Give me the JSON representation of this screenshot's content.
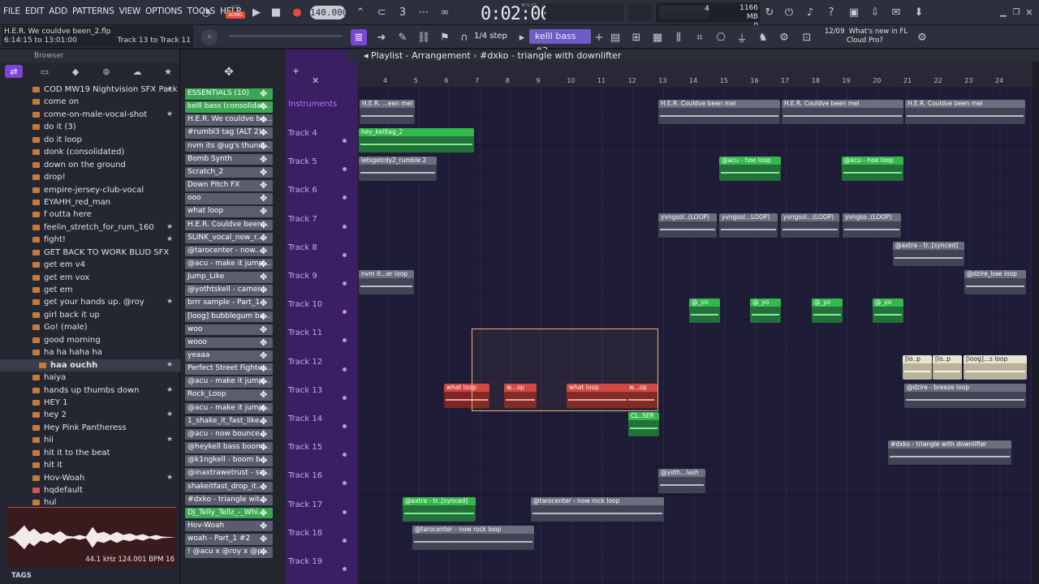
{
  "menu": [
    "FILE",
    "EDIT",
    "ADD",
    "PATTERNS",
    "VIEW",
    "OPTIONS",
    "TOOLS",
    "HELP"
  ],
  "transport": {
    "pat_label": "PAT",
    "song_label": "SONG",
    "tempo": "140.000",
    "time_unit": "M:S:CS",
    "time": "0:02:00",
    "cpu": "4",
    "memory": "1166 MB",
    "polyphony": "0"
  },
  "hint": {
    "file": "H.E.R. We couldve been_2.flp",
    "range": "6:14:15 to 13:01:00",
    "tracks": "Track 13 to Track 11"
  },
  "toolbar": {
    "snap": "1/4 step",
    "pattern": "kelll bass #2"
  },
  "news": {
    "date": "12/09",
    "line1": "What's new in FL",
    "line2": "Cloud Pro?"
  },
  "browser": {
    "title": "Browser",
    "items": [
      {
        "label": "COD MW19  Nightvision SFX Pack HQ",
        "star": true
      },
      {
        "label": "come on",
        "star": false
      },
      {
        "label": "come-on-male-vocal-shot",
        "star": true
      },
      {
        "label": "do it (3)",
        "star": false
      },
      {
        "label": "do it loop",
        "star": false
      },
      {
        "label": "donk (consolidated)",
        "star": false
      },
      {
        "label": "down on the ground",
        "star": false
      },
      {
        "label": "drop!",
        "star": false
      },
      {
        "label": "empire-jersey-club-vocal",
        "star": false
      },
      {
        "label": "EYAHH_red_man",
        "star": false
      },
      {
        "label": "f outta here",
        "star": false
      },
      {
        "label": "feelin_stretch_for_rum_160",
        "star": true
      },
      {
        "label": "fight!",
        "star": true
      },
      {
        "label": "GET BACK TO WORK BLUD SFX",
        "star": false
      },
      {
        "label": "get em v4",
        "star": false
      },
      {
        "label": "get em vox",
        "star": false
      },
      {
        "label": "get em",
        "star": false
      },
      {
        "label": "get your hands up. @roy",
        "star": true
      },
      {
        "label": "girl back it up",
        "star": false
      },
      {
        "label": "Go! (male)",
        "star": false
      },
      {
        "label": "good morning",
        "star": false
      },
      {
        "label": "ha ha haha ha",
        "star": false
      },
      {
        "label": "haa ouchh",
        "star": true,
        "selected": true
      },
      {
        "label": "haiya",
        "star": false
      },
      {
        "label": "hands up thumbs down",
        "star": true
      },
      {
        "label": "HEY 1",
        "star": false
      },
      {
        "label": "hey 2",
        "star": true
      },
      {
        "label": "Hey Pink Pantheress",
        "star": false
      },
      {
        "label": "hii",
        "star": true
      },
      {
        "label": "hit it to the beat",
        "star": false
      },
      {
        "label": "hit it",
        "star": false
      },
      {
        "label": "Hov-Woah",
        "star": true
      },
      {
        "label": "hqdefault",
        "star": false,
        "folder": true
      },
      {
        "label": "hul",
        "star": false
      }
    ],
    "wave_info": "44.1 kHz 124.001 BPM 16",
    "tags_label": "TAGS"
  },
  "patterns": [
    {
      "label": "ESSENTIALS (10)",
      "color": "green"
    },
    {
      "label": "kelll bass (consolidat...",
      "color": "green"
    },
    {
      "label": "H.E.R. We couldve be...",
      "color": "grey"
    },
    {
      "label": "#rumbl3 tag (ALT 2)...",
      "color": "grey"
    },
    {
      "label": "nvm its @ug's thund...",
      "color": "grey"
    },
    {
      "label": "Bomb Synth",
      "color": "grey"
    },
    {
      "label": "Scratch_2",
      "color": "grey"
    },
    {
      "label": "Down Pitch FX",
      "color": "grey"
    },
    {
      "label": "ooo",
      "color": "grey"
    },
    {
      "label": "what loop",
      "color": "grey"
    },
    {
      "label": "H.E.R. Couldve been...",
      "color": "grey"
    },
    {
      "label": "SLINK_vocal_now_r...",
      "color": "grey"
    },
    {
      "label": "@tarocenter - now...",
      "color": "grey"
    },
    {
      "label": "@acu - make it jump...",
      "color": "grey"
    },
    {
      "label": "Jump_Like",
      "color": "grey"
    },
    {
      "label": "@yothtskell - camer...",
      "color": "grey"
    },
    {
      "label": "brrr sample - Part_1",
      "color": "grey"
    },
    {
      "label": "[loog] bubblegum ba...",
      "color": "grey"
    },
    {
      "label": "woo",
      "color": "grey"
    },
    {
      "label": "wooo",
      "color": "grey"
    },
    {
      "label": "yeaaa",
      "color": "grey"
    },
    {
      "label": "Perfect Street Fighter...",
      "color": "grey"
    },
    {
      "label": "@acu - make it jump...",
      "color": "grey"
    },
    {
      "label": "Rock_Loop",
      "color": "grey"
    },
    {
      "label": "@acu - make it jump...",
      "color": "grey"
    },
    {
      "label": "1_shake_it_fast_like...",
      "color": "grey"
    },
    {
      "label": "@acu - now bounce...",
      "color": "grey"
    },
    {
      "label": "@heykell bass boom...",
      "color": "grey"
    },
    {
      "label": "@k1ngkell - boom b...",
      "color": "grey"
    },
    {
      "label": "@inaxtrawetrust - sc...",
      "color": "grey"
    },
    {
      "label": "shakeitfast_drop_it...",
      "color": "grey"
    },
    {
      "label": "#dxko - triangle wit...",
      "color": "grey"
    },
    {
      "label": "DJ_Telly_Tellz_-_Whi...",
      "color": "green"
    },
    {
      "label": "Hov-Woah",
      "color": "grey"
    },
    {
      "label": "woah - Part_1 #2",
      "color": "grey"
    },
    {
      "label": "! @acu x @roy x @p...",
      "color": "grey"
    }
  ],
  "tracks": {
    "header": "Instruments",
    "labels": [
      "Track 4",
      "Track 5",
      "Track 6",
      "Track 7",
      "Track 8",
      "Track 9",
      "Track 10",
      "Track 11",
      "Track 12",
      "Track 13",
      "Track 14",
      "Track 15",
      "Track 16",
      "Track 17",
      "Track 18",
      "Track 19"
    ]
  },
  "playlist": {
    "title_prefix": "Playlist - Arrangement",
    "title_pattern": "#dxko - triangle with downlifter",
    "ruler": [
      "4",
      "5",
      "6",
      "7",
      "8",
      "9",
      "10",
      "11",
      "12",
      "13",
      "14",
      "15",
      "16",
      "17",
      "18",
      "19",
      "20",
      "21",
      "22",
      "23",
      "24"
    ],
    "clips": [
      {
        "label": "H.E.R. ...een mel",
        "color": "grey",
        "row": 0
      },
      {
        "label": "H.E.R. Couldve been mel",
        "color": "grey",
        "row": 0
      },
      {
        "label": "H.E.R. Couldve been mel",
        "color": "grey",
        "row": 0
      },
      {
        "label": "H.E.R. Couldve been mel",
        "color": "grey",
        "row": 0
      },
      {
        "label": "hey_kelltag_2",
        "color": "green",
        "row": 1
      },
      {
        "label": "letsgetrdy2_rumble 2",
        "color": "grey",
        "row": 2
      },
      {
        "label": "@acu - hoe loop",
        "color": "green",
        "row": 2
      },
      {
        "label": "@acu - hoe loop",
        "color": "green",
        "row": 2
      },
      {
        "label": "yvngsol..(LOOP)",
        "color": "grey",
        "row": 4
      },
      {
        "label": "yvngsol...LOOP)",
        "color": "grey",
        "row": 4
      },
      {
        "label": "yvngsol...(LOOP)",
        "color": "grey",
        "row": 4
      },
      {
        "label": "yvngso..(LOOP)",
        "color": "grey",
        "row": 4
      },
      {
        "label": "@axtra - tr..[synced]",
        "color": "grey",
        "row": 5
      },
      {
        "label": "nvm it...er loop",
        "color": "grey",
        "row": 6
      },
      {
        "label": "@dzire_bae loop",
        "color": "grey",
        "row": 6
      },
      {
        "label": "@_yo",
        "color": "green",
        "row": 7
      },
      {
        "label": "@_yo",
        "color": "green",
        "row": 7
      },
      {
        "label": "@_yo",
        "color": "green",
        "row": 7
      },
      {
        "label": "@_yo",
        "color": "green",
        "row": 7
      },
      {
        "label": "what loop",
        "color": "red",
        "row": 10
      },
      {
        "label": "w...op",
        "color": "red",
        "row": 10
      },
      {
        "label": "what loop",
        "color": "red",
        "row": 10
      },
      {
        "label": "w...op",
        "color": "red",
        "row": 10
      },
      {
        "label": "@dzire - breeze loop",
        "color": "grey",
        "row": 10
      },
      {
        "label": "[lo..p",
        "color": "cream",
        "row": 9
      },
      {
        "label": "[lo..p",
        "color": "cream",
        "row": 9
      },
      {
        "label": "[loog]...s loop",
        "color": "cream",
        "row": 9
      },
      {
        "label": "CL..SER",
        "color": "green",
        "row": 11
      },
      {
        "label": "#dxko - triangle with downlifter",
        "color": "grey",
        "row": 12
      },
      {
        "label": "@yoth...lash",
        "color": "grey",
        "row": 13
      },
      {
        "label": "@axtra - tr..[synced]",
        "color": "green",
        "row": 14
      },
      {
        "label": "@tarocenter -  now rock loop",
        "color": "grey",
        "row": 14
      },
      {
        "label": "@tarocenter -  now rock loop",
        "color": "grey",
        "row": 15
      }
    ]
  },
  "colors": {
    "accent": "#7b46d8",
    "track_label_bg": "#3a1f62",
    "selection": "#f0b37a"
  }
}
